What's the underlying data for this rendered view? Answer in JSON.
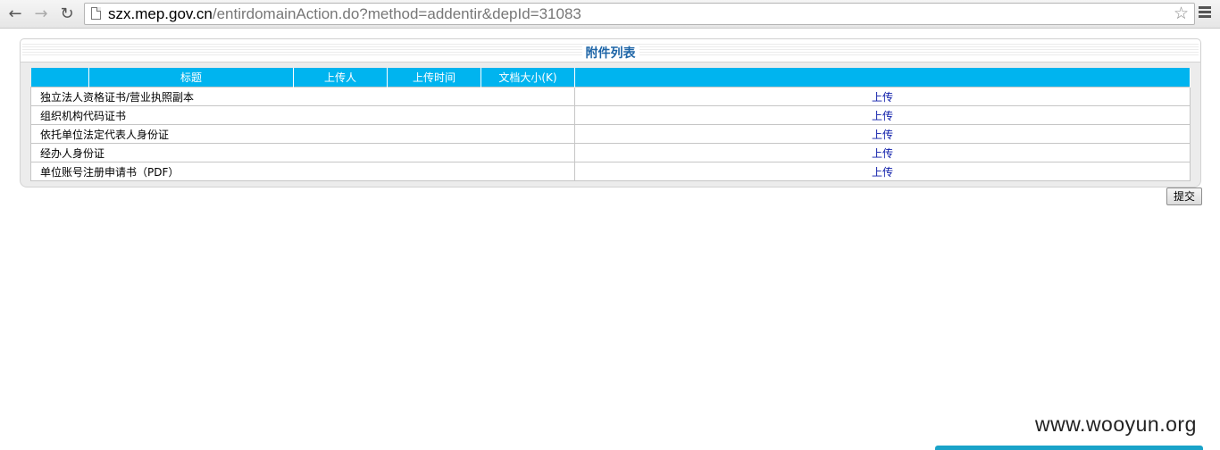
{
  "browser": {
    "url_host": "szx.mep.gov.cn",
    "url_rest": "/entirdomainAction.do?method=addentir&depId=31083"
  },
  "panel": {
    "title": "附件列表"
  },
  "table": {
    "headers": [
      "",
      "标题",
      "上传人",
      "上传时间",
      "文档大小(K)",
      ""
    ],
    "rows": [
      {
        "name": "独立法人资格证书/营业执照副本",
        "action": "上传"
      },
      {
        "name": "组织机构代码证书",
        "action": "上传"
      },
      {
        "name": "依托单位法定代表人身份证",
        "action": "上传"
      },
      {
        "name": "经办人身份证",
        "action": "上传"
      },
      {
        "name": "单位账号注册申请书（PDF）",
        "action": "上传"
      }
    ]
  },
  "submit_label": "提交",
  "watermark": "www.wooyun.org"
}
